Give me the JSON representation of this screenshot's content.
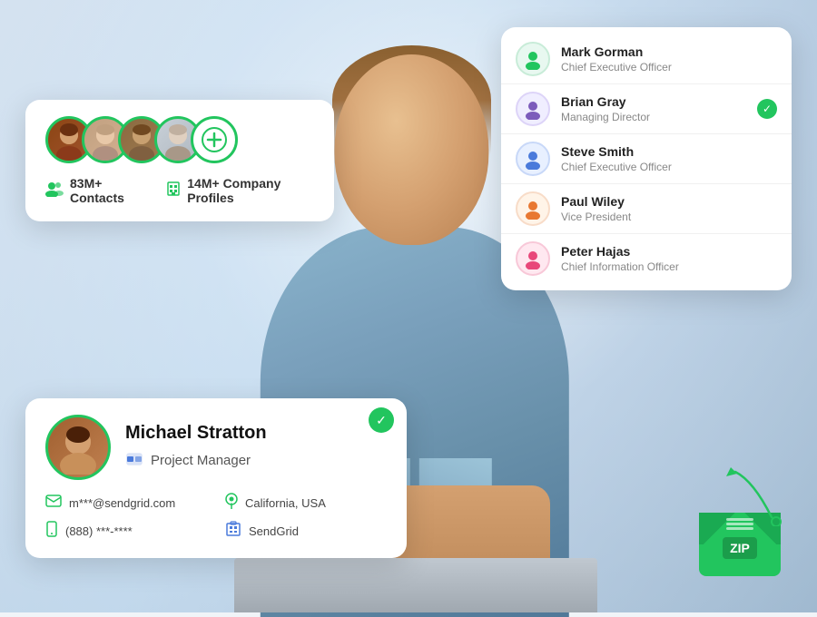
{
  "background": {
    "gradient_start": "#d8e8f4",
    "gradient_end": "#b0c8e0"
  },
  "contacts_card": {
    "stats": [
      {
        "label": "83M+ Contacts",
        "icon": "people-icon"
      },
      {
        "label": "14M+ Company Profiles",
        "icon": "building-icon"
      }
    ],
    "avatars": [
      {
        "color": "brown",
        "initial": ""
      },
      {
        "color": "beige",
        "initial": ""
      },
      {
        "color": "tan",
        "initial": ""
      },
      {
        "color": "silver",
        "initial": ""
      }
    ],
    "add_label": "+"
  },
  "people_card": {
    "people": [
      {
        "name": "Mark Gorman",
        "title": "Chief Executive Officer",
        "avatar_color": "green",
        "has_check": false
      },
      {
        "name": "Brian Gray",
        "title": "Managing Director",
        "avatar_color": "purple",
        "has_check": true
      },
      {
        "name": "Steve Smith",
        "title": "Chief Executive Officer",
        "avatar_color": "blue",
        "has_check": false
      },
      {
        "name": "Paul Wiley",
        "title": "Vice President",
        "avatar_color": "orange",
        "has_check": false
      },
      {
        "name": "Peter Hajas",
        "title": "Chief Information Officer",
        "avatar_color": "pink",
        "has_check": false
      }
    ]
  },
  "contact_card": {
    "name": "Michael Stratton",
    "role": "Project Manager",
    "email": "m***@sendgrid.com",
    "phone": "(888) ***-****",
    "location": "California, USA",
    "company": "SendGrid",
    "has_check": true
  },
  "zip_decoration": {
    "label": "ZIP"
  }
}
